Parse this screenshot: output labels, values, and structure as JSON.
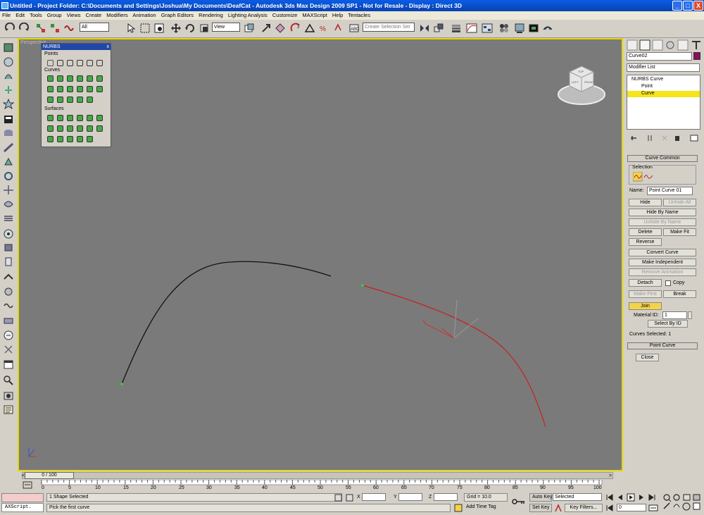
{
  "title": "Untitled     - Project Folder: C:\\Documents and Settings\\Joshua\\My Documents\\DeafCat     - Autodesk 3ds Max Design 2009 SP1  - Not for Resale     - Display : Direct 3D",
  "window_buttons": [
    "_",
    "□",
    "X"
  ],
  "menu": [
    "File",
    "Edit",
    "Tools",
    "Group",
    "Views",
    "Create",
    "Modifiers",
    "Animation",
    "Graph Editors",
    "Rendering",
    "Lighting Analysis",
    "Customize",
    "MAXScript",
    "Help",
    "Tentacles"
  ],
  "toolbar": {
    "selection_filter": "All",
    "ref_coord": "View",
    "named_selection_placeholder": "Create Selection Set"
  },
  "viewport": {
    "label": "Perspective",
    "viewcube_labels": [
      "TOP",
      "LEFT",
      "FRONT"
    ]
  },
  "nurbs_toolbox": {
    "title": "NURBS",
    "close": "x",
    "sections": [
      "Points",
      "Curves",
      "Surfaces"
    ]
  },
  "command_panel": {
    "object_name": "Curve02",
    "object_color": "#8b0f5e",
    "modifier_list": "Modifier List",
    "stack": [
      "NURBS Curve",
      "Point",
      "Curve"
    ],
    "curve_common": {
      "title": "Curve Common",
      "selection_group": "Selection",
      "name_label": "Name:",
      "name_value": "Point Curve 01",
      "hide": "Hide",
      "unhide_all": "Unhide All",
      "hide_by_name": "Hide By Name",
      "unhide_by_name": "Unhide By Name",
      "delete": "Delete",
      "make_fit": "Make Fit",
      "reverse": "Reverse",
      "convert_curve": "Convert Curve",
      "make_independent": "Make Independent",
      "remove_animation": "Remove Animation",
      "detach": "Detach",
      "copy": "Copy",
      "make_first": "Make First",
      "break": "Break",
      "join": "Join",
      "material_id_label": "Material ID:",
      "material_id_value": "1",
      "select_by_id": "Select By ID",
      "curves_selected": "Curves Selected: 1"
    },
    "point_curve": {
      "title": "Point Curve",
      "close": "Close"
    }
  },
  "timeline": {
    "frame": "0 / 100",
    "ticks": [
      "0",
      "5",
      "10",
      "15",
      "20",
      "25",
      "30",
      "35",
      "40",
      "45",
      "50",
      "55",
      "60",
      "65",
      "70",
      "75",
      "80",
      "85",
      "90",
      "95",
      "100"
    ]
  },
  "status": {
    "maxscript": "AXScript.",
    "selected": "1 Shape Selected",
    "prompt": "Pick the first curve",
    "x_label": "X",
    "y_label": "Y",
    "z_label": "Z",
    "grid": "Grid = 10.0",
    "add_time_tag": "Add Time Tag",
    "auto_key": "Auto Key",
    "set_key": "Set Key",
    "selected_option": "Selected",
    "key_filters": "Key Filters...",
    "frame_value": "0"
  }
}
